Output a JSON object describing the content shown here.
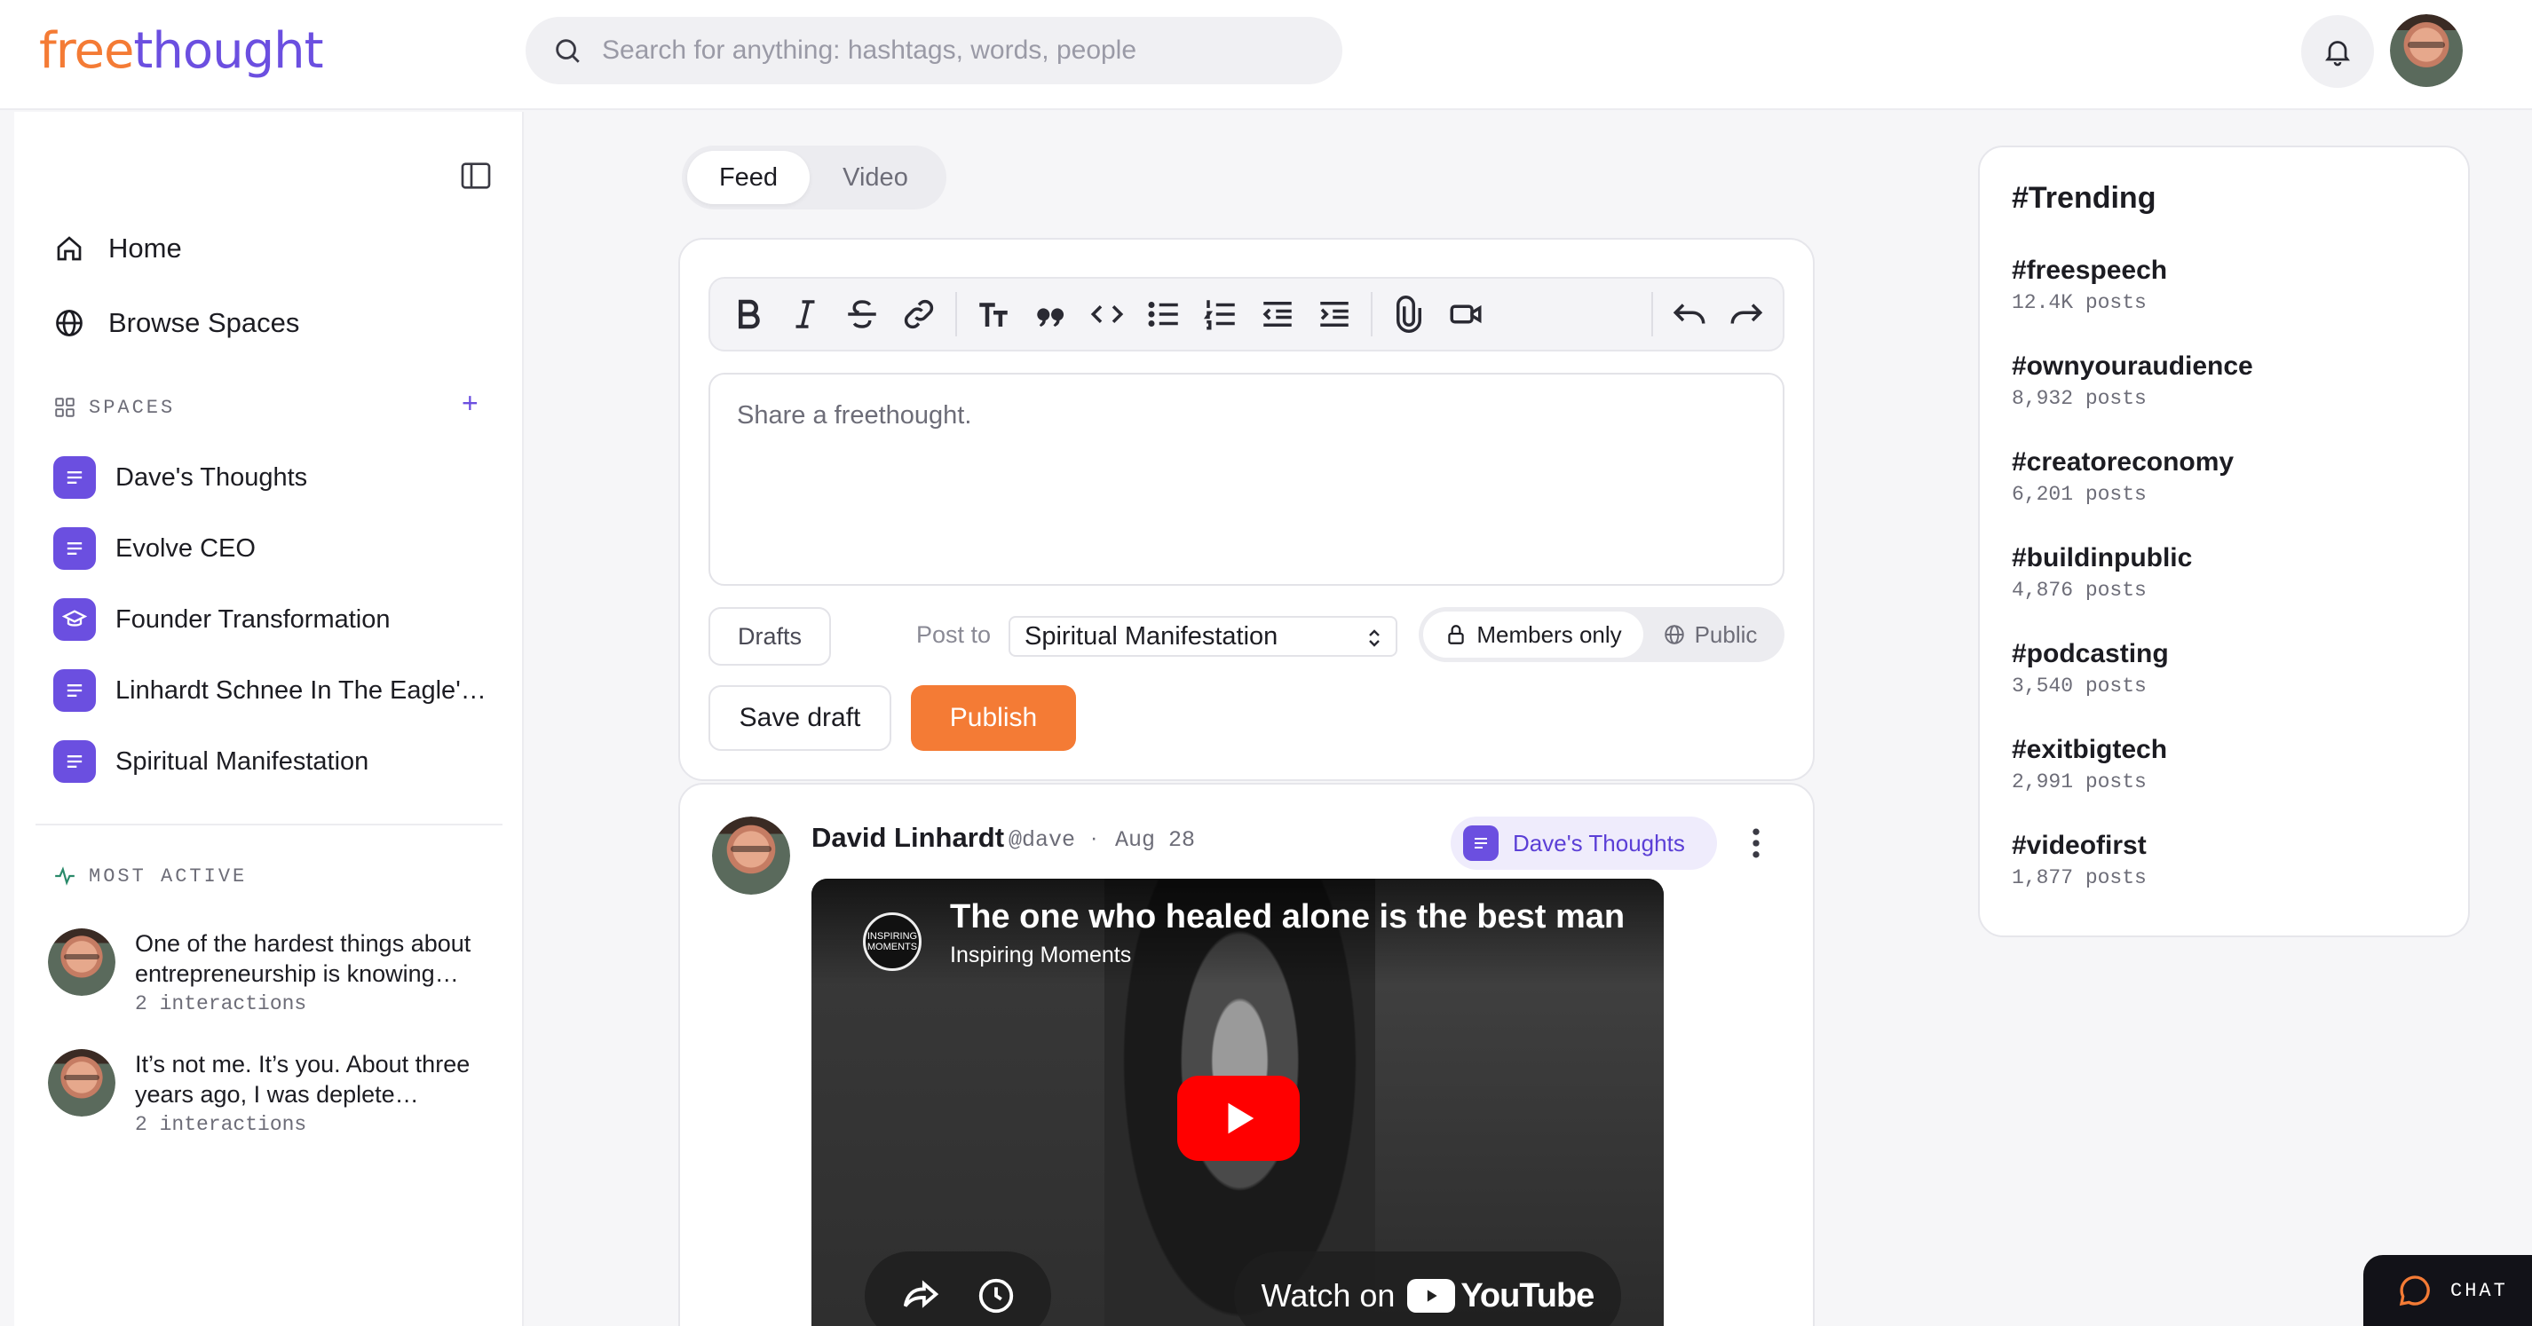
{
  "header": {
    "logo_part1": "free",
    "logo_part2": "thought",
    "search_placeholder": "Search for anything: hashtags, words, people"
  },
  "sidebar": {
    "nav": [
      {
        "label": "Home",
        "icon": "home-icon"
      },
      {
        "label": "Browse Spaces",
        "icon": "globe-icon"
      }
    ],
    "spaces_label": "SPACES",
    "add_label": "+",
    "spaces": [
      {
        "label": "Dave's Thoughts",
        "icon": "document-icon"
      },
      {
        "label": "Evolve CEO",
        "icon": "document-icon"
      },
      {
        "label": "Founder Transformation",
        "icon": "graduation-cap-icon"
      },
      {
        "label": "Linhardt Schnee In The Eagle's ...",
        "icon": "document-icon"
      },
      {
        "label": "Spiritual Manifestation",
        "icon": "document-icon"
      }
    ],
    "most_active_label": "MOST ACTIVE",
    "most_active": [
      {
        "text": "One of the hardest things about entrepreneurship is knowing…",
        "meta": "2 interactions"
      },
      {
        "text": "It’s not me. It’s you. About three years ago, I was deplete…",
        "meta": "2 interactions"
      }
    ]
  },
  "tabs": [
    {
      "label": "Feed",
      "active": true
    },
    {
      "label": "Video",
      "active": false
    }
  ],
  "composer": {
    "placeholder": "Share a freethought.",
    "drafts_label": "Drafts",
    "post_to_label": "Post to",
    "post_to_value": "Spiritual Manifestation",
    "visibility_members": "Members only",
    "visibility_public": "Public",
    "save_draft_label": "Save draft",
    "publish_label": "Publish"
  },
  "post": {
    "author": "David Linhardt",
    "handle": "@dave",
    "separator": "·",
    "date": "Aug 28",
    "space": "Dave's Thoughts",
    "video": {
      "title": "The one who healed alone is the best man",
      "channel": "Inspiring Moments",
      "channel_logo_text": "INSPIRING MOMENTS",
      "watch_on": "Watch on",
      "youtube_word": "YouTube"
    }
  },
  "trending": {
    "title": "#Trending",
    "items": [
      {
        "tag": "#freespeech",
        "count": "12.4K posts"
      },
      {
        "tag": "#ownyouraudience",
        "count": "8,932 posts"
      },
      {
        "tag": "#creatoreconomy",
        "count": "6,201 posts"
      },
      {
        "tag": "#buildinpublic",
        "count": "4,876 posts"
      },
      {
        "tag": "#podcasting",
        "count": "3,540 posts"
      },
      {
        "tag": "#exitbigtech",
        "count": "2,991 posts"
      },
      {
        "tag": "#videofirst",
        "count": "1,877 posts"
      }
    ]
  },
  "chat": {
    "label": "CHAT"
  },
  "colors": {
    "brand_orange": "#f47b35",
    "brand_purple": "#6b4fe0",
    "youtube_red": "#ff0000"
  }
}
